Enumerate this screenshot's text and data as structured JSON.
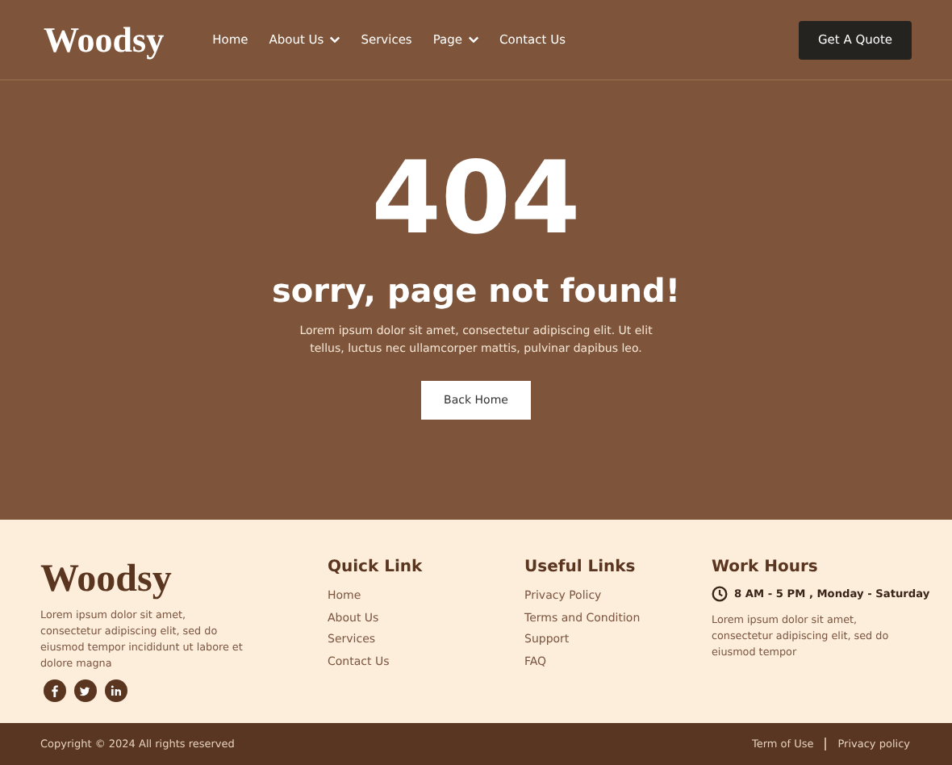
{
  "header": {
    "logo": "Woodsy",
    "nav": [
      {
        "label": "Home",
        "has_menu": false
      },
      {
        "label": "About Us",
        "has_menu": true
      },
      {
        "label": "Services",
        "has_menu": false
      },
      {
        "label": "Page",
        "has_menu": true
      },
      {
        "label": "Contact Us",
        "has_menu": false
      }
    ],
    "cta": "Get A Quote"
  },
  "hero": {
    "code": "404",
    "title": "sorry, page not found!",
    "text": "Lorem ipsum dolor sit amet, consectetur adipiscing elit. Ut elit tellus, luctus nec ullamcorper mattis, pulvinar dapibus leo.",
    "button": "Back Home"
  },
  "footer": {
    "logo": "Woodsy",
    "about": "Lorem ipsum dolor sit amet, consectetur adipiscing elit, sed do eiusmod tempor incididunt ut labore et dolore magna",
    "columns": [
      {
        "title": "Quick Link",
        "links": [
          "Home",
          "About Us",
          "Services",
          "Contact Us"
        ]
      },
      {
        "title": "Useful Links",
        "links": [
          "Privacy Policy",
          "Terms and Condition",
          "Support",
          "FAQ"
        ]
      }
    ],
    "hours": {
      "title": "Work Hours",
      "time": "8 AM - 5 PM , Monday - Saturday",
      "text": "Lorem ipsum dolor sit amet, consectetur adipiscing elit, sed do eiusmod tempor"
    }
  },
  "bottom": {
    "copyright": "Copyright © 2024 All rights reserved",
    "links": [
      "Term of Use",
      "Privacy policy"
    ]
  }
}
